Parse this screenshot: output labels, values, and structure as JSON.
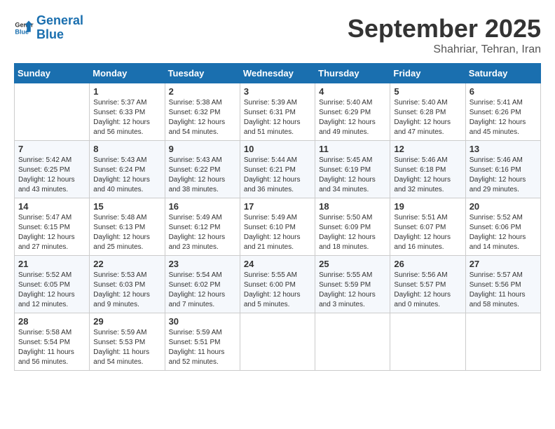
{
  "header": {
    "logo_line1": "General",
    "logo_line2": "Blue",
    "month": "September 2025",
    "location": "Shahriar, Tehran, Iran"
  },
  "weekdays": [
    "Sunday",
    "Monday",
    "Tuesday",
    "Wednesday",
    "Thursday",
    "Friday",
    "Saturday"
  ],
  "weeks": [
    [
      {
        "day": "",
        "info": ""
      },
      {
        "day": "1",
        "info": "Sunrise: 5:37 AM\nSunset: 6:33 PM\nDaylight: 12 hours\nand 56 minutes."
      },
      {
        "day": "2",
        "info": "Sunrise: 5:38 AM\nSunset: 6:32 PM\nDaylight: 12 hours\nand 54 minutes."
      },
      {
        "day": "3",
        "info": "Sunrise: 5:39 AM\nSunset: 6:31 PM\nDaylight: 12 hours\nand 51 minutes."
      },
      {
        "day": "4",
        "info": "Sunrise: 5:40 AM\nSunset: 6:29 PM\nDaylight: 12 hours\nand 49 minutes."
      },
      {
        "day": "5",
        "info": "Sunrise: 5:40 AM\nSunset: 6:28 PM\nDaylight: 12 hours\nand 47 minutes."
      },
      {
        "day": "6",
        "info": "Sunrise: 5:41 AM\nSunset: 6:26 PM\nDaylight: 12 hours\nand 45 minutes."
      }
    ],
    [
      {
        "day": "7",
        "info": "Sunrise: 5:42 AM\nSunset: 6:25 PM\nDaylight: 12 hours\nand 43 minutes."
      },
      {
        "day": "8",
        "info": "Sunrise: 5:43 AM\nSunset: 6:24 PM\nDaylight: 12 hours\nand 40 minutes."
      },
      {
        "day": "9",
        "info": "Sunrise: 5:43 AM\nSunset: 6:22 PM\nDaylight: 12 hours\nand 38 minutes."
      },
      {
        "day": "10",
        "info": "Sunrise: 5:44 AM\nSunset: 6:21 PM\nDaylight: 12 hours\nand 36 minutes."
      },
      {
        "day": "11",
        "info": "Sunrise: 5:45 AM\nSunset: 6:19 PM\nDaylight: 12 hours\nand 34 minutes."
      },
      {
        "day": "12",
        "info": "Sunrise: 5:46 AM\nSunset: 6:18 PM\nDaylight: 12 hours\nand 32 minutes."
      },
      {
        "day": "13",
        "info": "Sunrise: 5:46 AM\nSunset: 6:16 PM\nDaylight: 12 hours\nand 29 minutes."
      }
    ],
    [
      {
        "day": "14",
        "info": "Sunrise: 5:47 AM\nSunset: 6:15 PM\nDaylight: 12 hours\nand 27 minutes."
      },
      {
        "day": "15",
        "info": "Sunrise: 5:48 AM\nSunset: 6:13 PM\nDaylight: 12 hours\nand 25 minutes."
      },
      {
        "day": "16",
        "info": "Sunrise: 5:49 AM\nSunset: 6:12 PM\nDaylight: 12 hours\nand 23 minutes."
      },
      {
        "day": "17",
        "info": "Sunrise: 5:49 AM\nSunset: 6:10 PM\nDaylight: 12 hours\nand 21 minutes."
      },
      {
        "day": "18",
        "info": "Sunrise: 5:50 AM\nSunset: 6:09 PM\nDaylight: 12 hours\nand 18 minutes."
      },
      {
        "day": "19",
        "info": "Sunrise: 5:51 AM\nSunset: 6:07 PM\nDaylight: 12 hours\nand 16 minutes."
      },
      {
        "day": "20",
        "info": "Sunrise: 5:52 AM\nSunset: 6:06 PM\nDaylight: 12 hours\nand 14 minutes."
      }
    ],
    [
      {
        "day": "21",
        "info": "Sunrise: 5:52 AM\nSunset: 6:05 PM\nDaylight: 12 hours\nand 12 minutes."
      },
      {
        "day": "22",
        "info": "Sunrise: 5:53 AM\nSunset: 6:03 PM\nDaylight: 12 hours\nand 9 minutes."
      },
      {
        "day": "23",
        "info": "Sunrise: 5:54 AM\nSunset: 6:02 PM\nDaylight: 12 hours\nand 7 minutes."
      },
      {
        "day": "24",
        "info": "Sunrise: 5:55 AM\nSunset: 6:00 PM\nDaylight: 12 hours\nand 5 minutes."
      },
      {
        "day": "25",
        "info": "Sunrise: 5:55 AM\nSunset: 5:59 PM\nDaylight: 12 hours\nand 3 minutes."
      },
      {
        "day": "26",
        "info": "Sunrise: 5:56 AM\nSunset: 5:57 PM\nDaylight: 12 hours\nand 0 minutes."
      },
      {
        "day": "27",
        "info": "Sunrise: 5:57 AM\nSunset: 5:56 PM\nDaylight: 11 hours\nand 58 minutes."
      }
    ],
    [
      {
        "day": "28",
        "info": "Sunrise: 5:58 AM\nSunset: 5:54 PM\nDaylight: 11 hours\nand 56 minutes."
      },
      {
        "day": "29",
        "info": "Sunrise: 5:59 AM\nSunset: 5:53 PM\nDaylight: 11 hours\nand 54 minutes."
      },
      {
        "day": "30",
        "info": "Sunrise: 5:59 AM\nSunset: 5:51 PM\nDaylight: 11 hours\nand 52 minutes."
      },
      {
        "day": "",
        "info": ""
      },
      {
        "day": "",
        "info": ""
      },
      {
        "day": "",
        "info": ""
      },
      {
        "day": "",
        "info": ""
      }
    ]
  ]
}
